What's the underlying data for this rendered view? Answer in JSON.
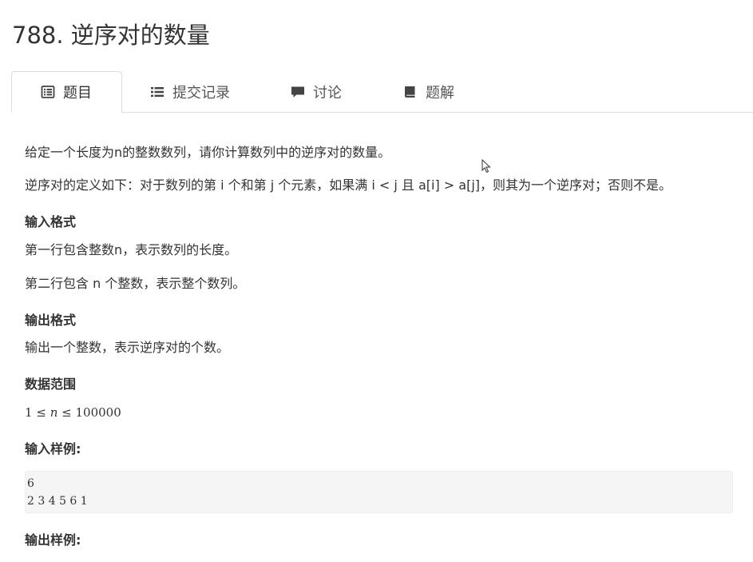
{
  "problem": {
    "title": "788. 逆序对的数量"
  },
  "tabs": [
    {
      "label": "题目",
      "icon": "list-alt-icon",
      "active": true
    },
    {
      "label": "提交记录",
      "icon": "list-icon",
      "active": false
    },
    {
      "label": "讨论",
      "icon": "comment-icon",
      "active": false
    },
    {
      "label": "题解",
      "icon": "book-icon",
      "active": false
    }
  ],
  "description": {
    "p1": "给定一个长度为n的整数数列，请你计算数列中的逆序对的数量。",
    "p2": "逆序对的定义如下：对于数列的第 i 个和第 j 个元素，如果满 i < j 且 a[i] > a[j]，则其为一个逆序对；否则不是。"
  },
  "input_format": {
    "heading": "输入格式",
    "line1": "第一行包含整数n，表示数列的长度。",
    "line2": "第二行包含 n 个整数，表示整个数列。"
  },
  "output_format": {
    "heading": "输出格式",
    "line1": "输出一个整数，表示逆序对的个数。"
  },
  "data_range": {
    "heading": "数据范围",
    "lower": "1",
    "op1": "≤",
    "var": "n",
    "op2": "≤",
    "upper": "100000"
  },
  "sample_input": {
    "heading": "输入样例:",
    "line1": "6",
    "line2": "2 3 4 5 6 1"
  },
  "sample_output": {
    "heading": "输出样例:"
  },
  "colors": {
    "text": "#333333",
    "tab_border": "#dddddd",
    "code_bg": "#f5f5f5"
  }
}
